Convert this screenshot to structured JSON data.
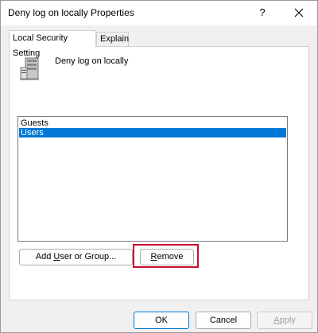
{
  "window": {
    "title": "Deny log on locally Properties",
    "help_glyph": "?",
    "accent_color": "#0078d7",
    "highlight_color": "#c8102e"
  },
  "tabs": [
    {
      "label": "Local Security Setting",
      "active": true
    },
    {
      "label": "Explain",
      "active": false
    }
  ],
  "policy": {
    "name": "Deny log on locally",
    "icon": "server-icon"
  },
  "list": {
    "items": [
      {
        "label": "Guests",
        "selected": false
      },
      {
        "label": "Users",
        "selected": true
      }
    ]
  },
  "actions": {
    "add_prefix": "Add ",
    "add_accel": "U",
    "add_suffix": "ser or Group...",
    "remove_accel": "R",
    "remove_suffix": "emove"
  },
  "footer": {
    "ok": "OK",
    "cancel": "Cancel",
    "apply_accel": "A",
    "apply_suffix": "pply"
  }
}
